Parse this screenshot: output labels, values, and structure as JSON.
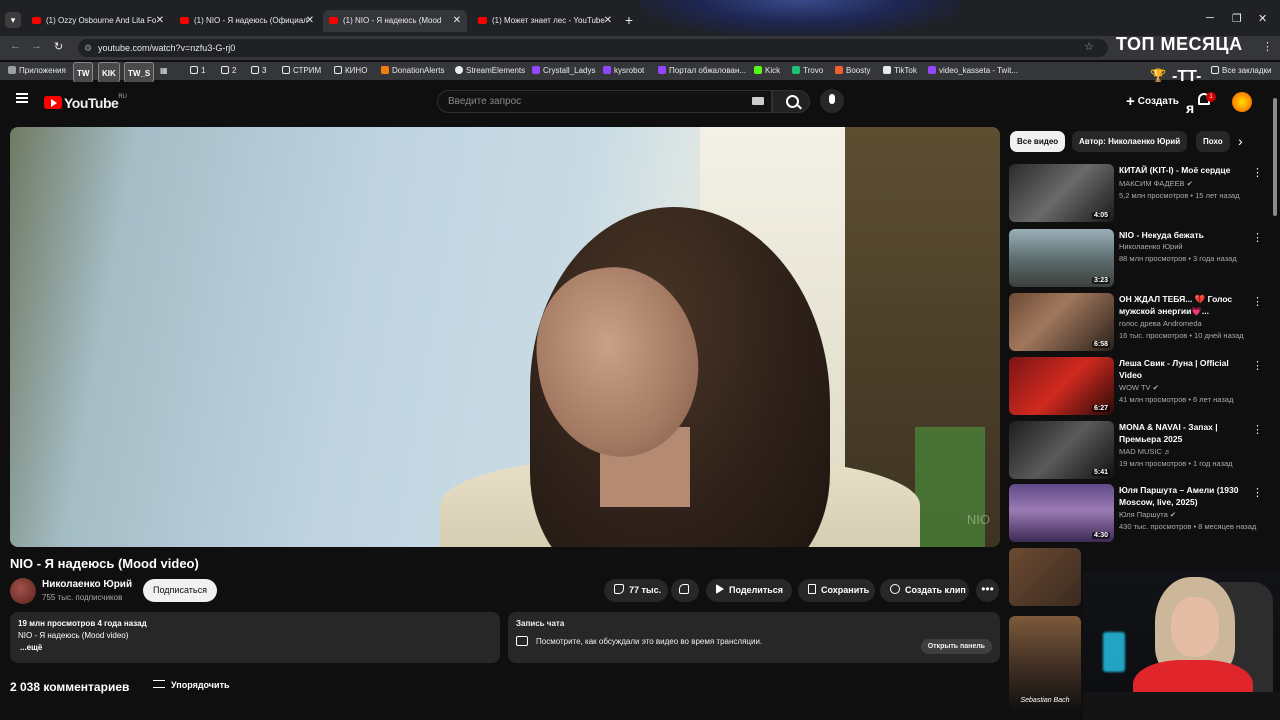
{
  "browser": {
    "tabs": [
      {
        "title": "(1) Ozzy Osbourne And Lita Fo"
      },
      {
        "title": "(1) NIO - Я надеюсь (Официал"
      },
      {
        "title": "(1) NIO - Я надеюсь (Mood"
      },
      {
        "title": "(1) Может знает лес - YouTube"
      }
    ],
    "url": "youtube.com/watch?v=nzfu3-G-rj0",
    "bookmarks": [
      "Приложения",
      "TW",
      "KIK",
      "TW_S",
      "1",
      "2",
      "3",
      "СТРИМ",
      "КИНО",
      "DonationAlerts",
      "StreamElements",
      "Crystall_Ladys",
      "kysrobot",
      "Портал обжалован...",
      "Kick",
      "Trovo",
      "Boosty",
      "TikTok",
      "video_kasseta - Twit..."
    ],
    "all_bookmarks": "Все закладки"
  },
  "overlay": {
    "top_month": "ТОП МЕСЯЦА",
    "nick": "-TT-",
    "letter": "я"
  },
  "youtube": {
    "logo_text": "YouTube",
    "logo_region": "RU",
    "search_placeholder": "Введите запрос",
    "create_label": "Создать",
    "notif_count": "1"
  },
  "video": {
    "title": "NIO - Я надеюсь (Mood video)",
    "watermark": "NIO",
    "channel": "Николаенко Юрий",
    "subscribers": "755 тыс. подписчиков",
    "subscribe_label": "Подписаться",
    "likes": "77 тыс.",
    "share_label": "Поделиться",
    "save_label": "Сохранить",
    "clip_label": "Создать клип",
    "more_label": "•••",
    "description": {
      "meta": "19 млн просмотров  4 года назад",
      "line": "NIO - Я надеюсь (Mood video)",
      "more": "...ещё"
    },
    "chat": {
      "title": "Запись чата",
      "text": "Посмотрите, как обсуждали это видео во время трансляции.",
      "open": "Открыть панель"
    },
    "comments_count": "2 038 комментариев",
    "sort_label": "Упорядочить"
  },
  "sidebar": {
    "chips": [
      "Все видео",
      "Автор: Николаенко Юрий",
      "Похо"
    ],
    "items": [
      {
        "title": "КИТАЙ (KIT-I) - Моё сердце",
        "channel": "МАКСИМ ФАДЕЕВ ✔",
        "meta": "5,2 млн просмотров • 15 лет назад",
        "duration": "4:05"
      },
      {
        "title": "NIO - Некуда бежать",
        "channel": "Николаенко Юрий",
        "meta": "88 млн просмотров • 3 года назад",
        "duration": "3:23"
      },
      {
        "title": "ОН ЖДАЛ ТЕБЯ... 💔 Голос мужской энергии💗...",
        "channel": "голос древа Andromeda",
        "meta": "16 тыс. просмотров • 10 дней назад",
        "duration": "6:58"
      },
      {
        "title": "Леша Свик - Луна | Official Video",
        "channel": "WOW TV ✔",
        "meta": "41 млн просмотров • 6 лет назад",
        "duration": "6:27"
      },
      {
        "title": "MONA & NAVAI - Запах | Премьера 2025",
        "channel": "MAD MUSIC ♬",
        "meta": "19 млн просмотров • 1 год назад",
        "duration": "5:41"
      },
      {
        "title": "Юля Паршута – Амели (1930 Moscow, live, 2025)",
        "channel": "Юля Паршута ✔",
        "meta": "430 тыс. просмотров • 8 месяцев назад",
        "duration": "4:30"
      }
    ],
    "extra_caption": "Sebastian Bach"
  },
  "colors": {
    "yt_red": "#ff0000",
    "bg": "#0f0f0f",
    "chip_bg": "#272727"
  }
}
